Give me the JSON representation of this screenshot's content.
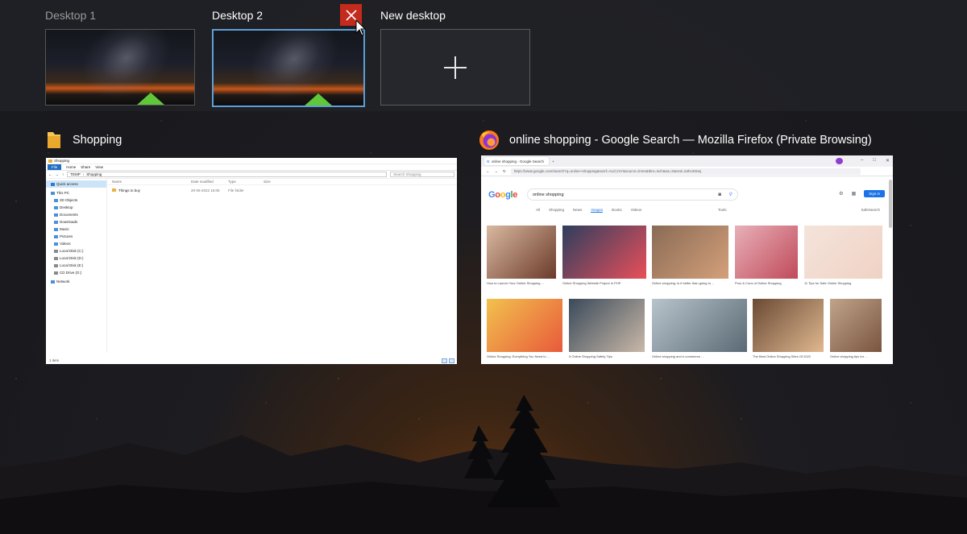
{
  "desktops": [
    {
      "label": "Desktop 1"
    },
    {
      "label": "Desktop 2"
    },
    {
      "label": "New desktop"
    }
  ],
  "windows": {
    "explorer": {
      "title": "Shopping",
      "icon": "folder-icon",
      "app": {
        "titlebar": "Shopping",
        "ribbon": [
          "File",
          "Home",
          "Share",
          "View"
        ],
        "path": [
          "TEMP",
          "Shopping"
        ],
        "search_placeholder": "Search Shopping",
        "nav": [
          "Quick access",
          "This PC",
          "3D Objects",
          "Desktop",
          "Documents",
          "Downloads",
          "Music",
          "Pictures",
          "Videos",
          "Local Disk (C:)",
          "Local Disk (D:)",
          "Local Disk (E:)",
          "CD Drive (G:)",
          "Network"
        ],
        "columns": [
          "Name",
          "Date modified",
          "Type",
          "Size"
        ],
        "files": [
          {
            "name": "Things to buy",
            "date": "20-06-2022 16:05",
            "type": "File folder",
            "size": ""
          }
        ],
        "status": "1 item"
      }
    },
    "firefox": {
      "title": "online shopping - Google Search — Mozilla Firefox (Private Browsing)",
      "icon": "firefox-icon",
      "app": {
        "tab_title": "online shopping - Google Search",
        "url": "https://www.google.com/search?q=online+shopping&sxsrf=ALiCzsY&source=lnms&tbm=isch&sa=X&ved=2ahUKEwj",
        "logo": "Google",
        "query": "online shopping",
        "signin": "Sign in",
        "tabs": [
          "All",
          "Shopping",
          "News",
          "Images",
          "Books",
          "Videos"
        ],
        "tools": "Tools",
        "safesearch": "SafeSearch",
        "results": [
          {
            "caption": "How to Launch Your Online Shopping ...",
            "colors": [
              "#d9b9a0",
              "#6b3a2a"
            ]
          },
          {
            "caption": "Online Shopping Website Project In PHP",
            "colors": [
              "#2d3e5e",
              "#e94f5a"
            ]
          },
          {
            "caption": "Online shopping: Is it better than going to ...",
            "colors": [
              "#8a6b55",
              "#d4a07a"
            ]
          },
          {
            "caption": "Pros & Cons of Online Shopping",
            "colors": [
              "#e8b0b8",
              "#c04a5a"
            ]
          },
          {
            "caption": "11 Tips for Safe Online Shopping",
            "colors": [
              "#f4e4dc",
              "#f0d2c4"
            ]
          },
          {
            "caption": "Online Shopping: Everything You Need to ...",
            "colors": [
              "#f2c14e",
              "#e85a3a"
            ]
          },
          {
            "caption": "5 Online Shopping Safety Tips",
            "colors": [
              "#3a4a5a",
              "#c9b8a8"
            ]
          },
          {
            "caption": "Online shopping and e-commerce ...",
            "colors": [
              "#b8c4cc",
              "#5a6a74"
            ]
          },
          {
            "caption": "The Best Online Shopping Sites Of 2022",
            "colors": [
              "#6a4a34",
              "#e0b890"
            ]
          },
          {
            "caption": "Online shopping tips for ...",
            "colors": [
              "#c0a48a",
              "#7a5440"
            ]
          }
        ]
      }
    }
  },
  "colors": {
    "close_button": "#c42b1c",
    "selected_border": "#5d9fd6",
    "file_tab": "#1f6fc4"
  }
}
